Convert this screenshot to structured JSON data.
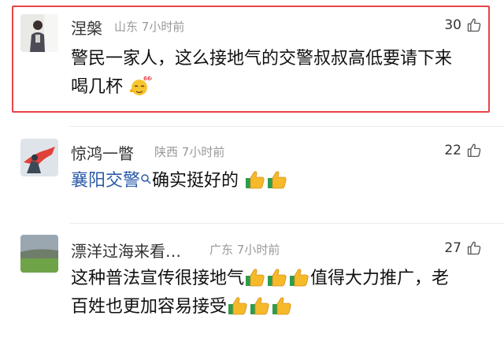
{
  "comments": [
    {
      "username": "涅槃",
      "location": "山东",
      "time": "7小时前",
      "likes": "30",
      "text_line1": "警民一家人，这么接地气的交警叔叔高低要请下来",
      "text_line2": "喝几杯",
      "emoji": "666-face-emoji"
    },
    {
      "username": "惊鸿一瞥",
      "location": "陕西",
      "time": "7小时前",
      "likes": "22",
      "mention": "襄阳交警",
      "text": "确实挺好的"
    },
    {
      "username": "漂洋过海来看…",
      "location": "广东",
      "time": "7小时前",
      "likes": "27",
      "text_line1_a": "这种普法宣传很接地气",
      "text_line1_b": "值得大力推广，老",
      "text_line2": "百姓也更加容易接受"
    }
  ],
  "colors": {
    "highlight_border": "#e8444a",
    "mention": "#2b5aa9",
    "meta": "#999999"
  },
  "icons": [
    "thumbs-up-outline-icon",
    "thumbs-up-emoji",
    "search-icon",
    "666-face-emoji"
  ]
}
